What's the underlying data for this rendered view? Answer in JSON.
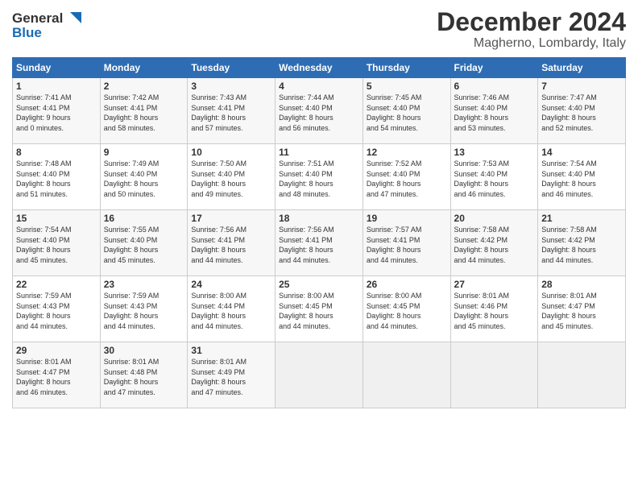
{
  "header": {
    "logo_line1": "General",
    "logo_line2": "Blue",
    "month_year": "December 2024",
    "location": "Magherno, Lombardy, Italy"
  },
  "weekdays": [
    "Sunday",
    "Monday",
    "Tuesday",
    "Wednesday",
    "Thursday",
    "Friday",
    "Saturday"
  ],
  "weeks": [
    [
      {
        "day": "1",
        "info": "Sunrise: 7:41 AM\nSunset: 4:41 PM\nDaylight: 9 hours\nand 0 minutes."
      },
      {
        "day": "2",
        "info": "Sunrise: 7:42 AM\nSunset: 4:41 PM\nDaylight: 8 hours\nand 58 minutes."
      },
      {
        "day": "3",
        "info": "Sunrise: 7:43 AM\nSunset: 4:41 PM\nDaylight: 8 hours\nand 57 minutes."
      },
      {
        "day": "4",
        "info": "Sunrise: 7:44 AM\nSunset: 4:40 PM\nDaylight: 8 hours\nand 56 minutes."
      },
      {
        "day": "5",
        "info": "Sunrise: 7:45 AM\nSunset: 4:40 PM\nDaylight: 8 hours\nand 54 minutes."
      },
      {
        "day": "6",
        "info": "Sunrise: 7:46 AM\nSunset: 4:40 PM\nDaylight: 8 hours\nand 53 minutes."
      },
      {
        "day": "7",
        "info": "Sunrise: 7:47 AM\nSunset: 4:40 PM\nDaylight: 8 hours\nand 52 minutes."
      }
    ],
    [
      {
        "day": "8",
        "info": "Sunrise: 7:48 AM\nSunset: 4:40 PM\nDaylight: 8 hours\nand 51 minutes."
      },
      {
        "day": "9",
        "info": "Sunrise: 7:49 AM\nSunset: 4:40 PM\nDaylight: 8 hours\nand 50 minutes."
      },
      {
        "day": "10",
        "info": "Sunrise: 7:50 AM\nSunset: 4:40 PM\nDaylight: 8 hours\nand 49 minutes."
      },
      {
        "day": "11",
        "info": "Sunrise: 7:51 AM\nSunset: 4:40 PM\nDaylight: 8 hours\nand 48 minutes."
      },
      {
        "day": "12",
        "info": "Sunrise: 7:52 AM\nSunset: 4:40 PM\nDaylight: 8 hours\nand 47 minutes."
      },
      {
        "day": "13",
        "info": "Sunrise: 7:53 AM\nSunset: 4:40 PM\nDaylight: 8 hours\nand 46 minutes."
      },
      {
        "day": "14",
        "info": "Sunrise: 7:54 AM\nSunset: 4:40 PM\nDaylight: 8 hours\nand 46 minutes."
      }
    ],
    [
      {
        "day": "15",
        "info": "Sunrise: 7:54 AM\nSunset: 4:40 PM\nDaylight: 8 hours\nand 45 minutes."
      },
      {
        "day": "16",
        "info": "Sunrise: 7:55 AM\nSunset: 4:40 PM\nDaylight: 8 hours\nand 45 minutes."
      },
      {
        "day": "17",
        "info": "Sunrise: 7:56 AM\nSunset: 4:41 PM\nDaylight: 8 hours\nand 44 minutes."
      },
      {
        "day": "18",
        "info": "Sunrise: 7:56 AM\nSunset: 4:41 PM\nDaylight: 8 hours\nand 44 minutes."
      },
      {
        "day": "19",
        "info": "Sunrise: 7:57 AM\nSunset: 4:41 PM\nDaylight: 8 hours\nand 44 minutes."
      },
      {
        "day": "20",
        "info": "Sunrise: 7:58 AM\nSunset: 4:42 PM\nDaylight: 8 hours\nand 44 minutes."
      },
      {
        "day": "21",
        "info": "Sunrise: 7:58 AM\nSunset: 4:42 PM\nDaylight: 8 hours\nand 44 minutes."
      }
    ],
    [
      {
        "day": "22",
        "info": "Sunrise: 7:59 AM\nSunset: 4:43 PM\nDaylight: 8 hours\nand 44 minutes."
      },
      {
        "day": "23",
        "info": "Sunrise: 7:59 AM\nSunset: 4:43 PM\nDaylight: 8 hours\nand 44 minutes."
      },
      {
        "day": "24",
        "info": "Sunrise: 8:00 AM\nSunset: 4:44 PM\nDaylight: 8 hours\nand 44 minutes."
      },
      {
        "day": "25",
        "info": "Sunrise: 8:00 AM\nSunset: 4:45 PM\nDaylight: 8 hours\nand 44 minutes."
      },
      {
        "day": "26",
        "info": "Sunrise: 8:00 AM\nSunset: 4:45 PM\nDaylight: 8 hours\nand 44 minutes."
      },
      {
        "day": "27",
        "info": "Sunrise: 8:01 AM\nSunset: 4:46 PM\nDaylight: 8 hours\nand 45 minutes."
      },
      {
        "day": "28",
        "info": "Sunrise: 8:01 AM\nSunset: 4:47 PM\nDaylight: 8 hours\nand 45 minutes."
      }
    ],
    [
      {
        "day": "29",
        "info": "Sunrise: 8:01 AM\nSunset: 4:47 PM\nDaylight: 8 hours\nand 46 minutes."
      },
      {
        "day": "30",
        "info": "Sunrise: 8:01 AM\nSunset: 4:48 PM\nDaylight: 8 hours\nand 47 minutes."
      },
      {
        "day": "31",
        "info": "Sunrise: 8:01 AM\nSunset: 4:49 PM\nDaylight: 8 hours\nand 47 minutes."
      },
      {
        "day": "",
        "info": ""
      },
      {
        "day": "",
        "info": ""
      },
      {
        "day": "",
        "info": ""
      },
      {
        "day": "",
        "info": ""
      }
    ]
  ]
}
